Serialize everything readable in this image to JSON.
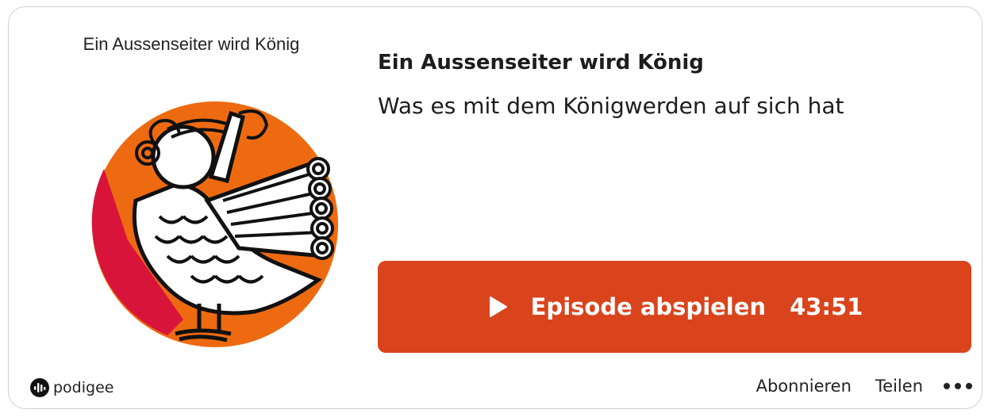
{
  "cover": {
    "title": "Ein Aussenseiter wird König",
    "artwork_icon": "siren-bird-illustration-icon",
    "colors": {
      "red": "#d9143a",
      "orange": "#ee6a11"
    }
  },
  "episode": {
    "title": "Ein Aussenseiter wird König",
    "subtitle": "Was es mit dem Königwerden auf sich hat"
  },
  "player": {
    "play_label": "Episode abspielen",
    "duration": "43:51",
    "play_icon": "play-icon",
    "accent": "#d9441c"
  },
  "brand": {
    "name": "podigee",
    "icon": "podigee-logo-icon"
  },
  "actions": {
    "subscribe": "Abonnieren",
    "share": "Teilen",
    "more_icon": "more-dots-icon"
  }
}
